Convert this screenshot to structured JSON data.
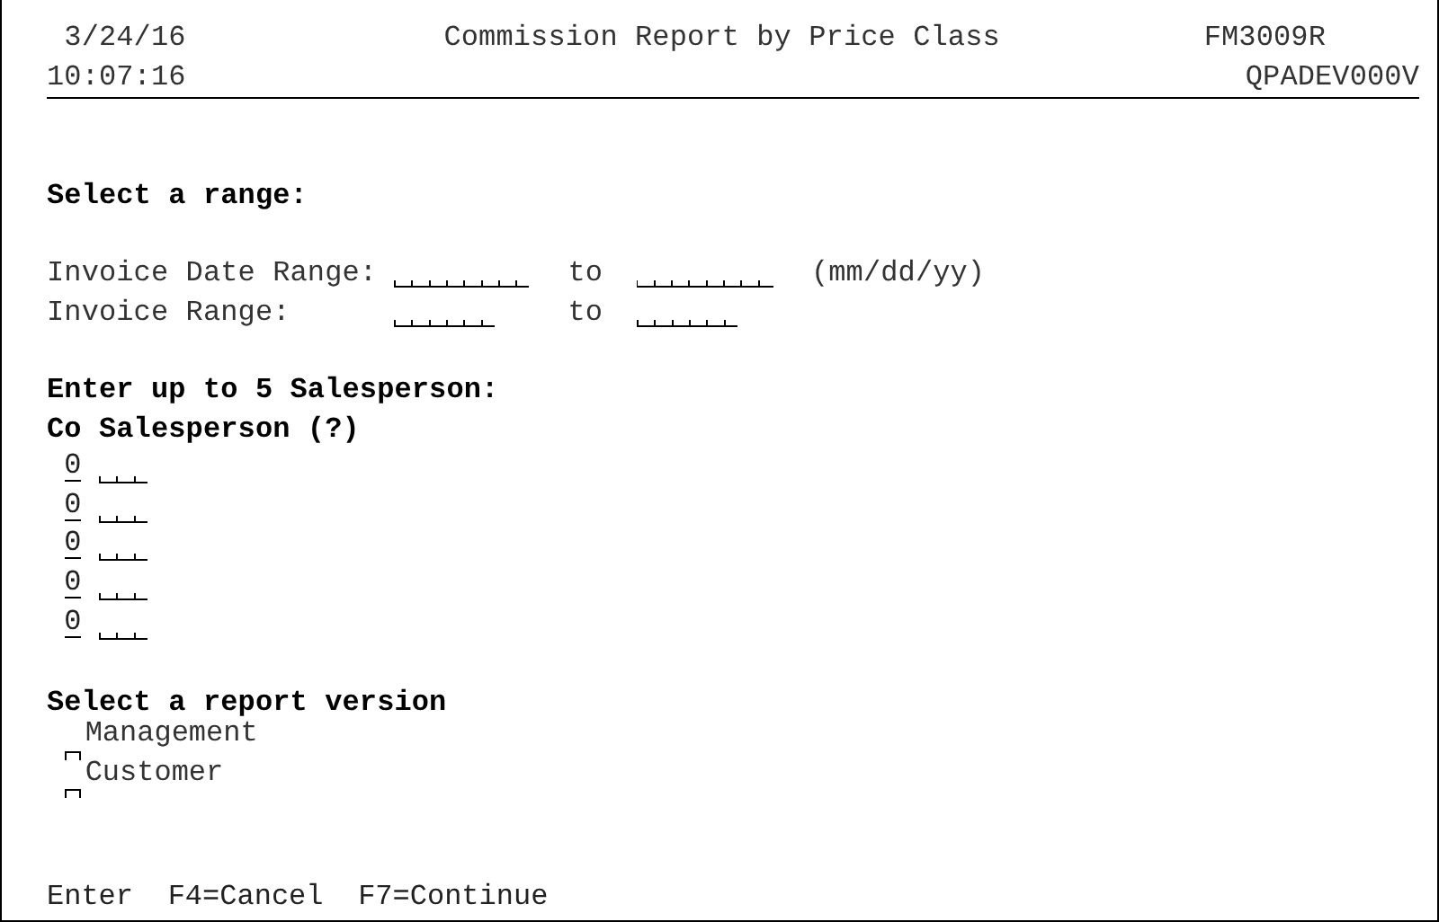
{
  "header": {
    "date": "3/24/16",
    "title": "Commission Report by Price Class",
    "program": "FM3009R",
    "time": "10:07:16",
    "device": "QPADEV000V"
  },
  "range": {
    "heading": "Select a range:",
    "rows": [
      {
        "label": "Invoice Date Range:",
        "kind": "date",
        "connector": "to",
        "hint": "(mm/dd/yy)"
      },
      {
        "label": "Invoice Range:",
        "kind": "number",
        "connector": "to"
      }
    ]
  },
  "salespersons": {
    "heading": "Enter up to 5 Salesperson:",
    "column_header": "Co Salesperson (?)",
    "entries": [
      {
        "company": "0"
      },
      {
        "company": "0"
      },
      {
        "company": "0"
      },
      {
        "company": "0"
      },
      {
        "company": "0"
      }
    ]
  },
  "report_version": {
    "heading": "Select a report version",
    "options": [
      {
        "label": "Management",
        "selected": false
      },
      {
        "label": "Customer",
        "selected": false
      }
    ]
  },
  "function_keys": [
    "Enter",
    "F4=Cancel",
    "F7=Continue"
  ]
}
